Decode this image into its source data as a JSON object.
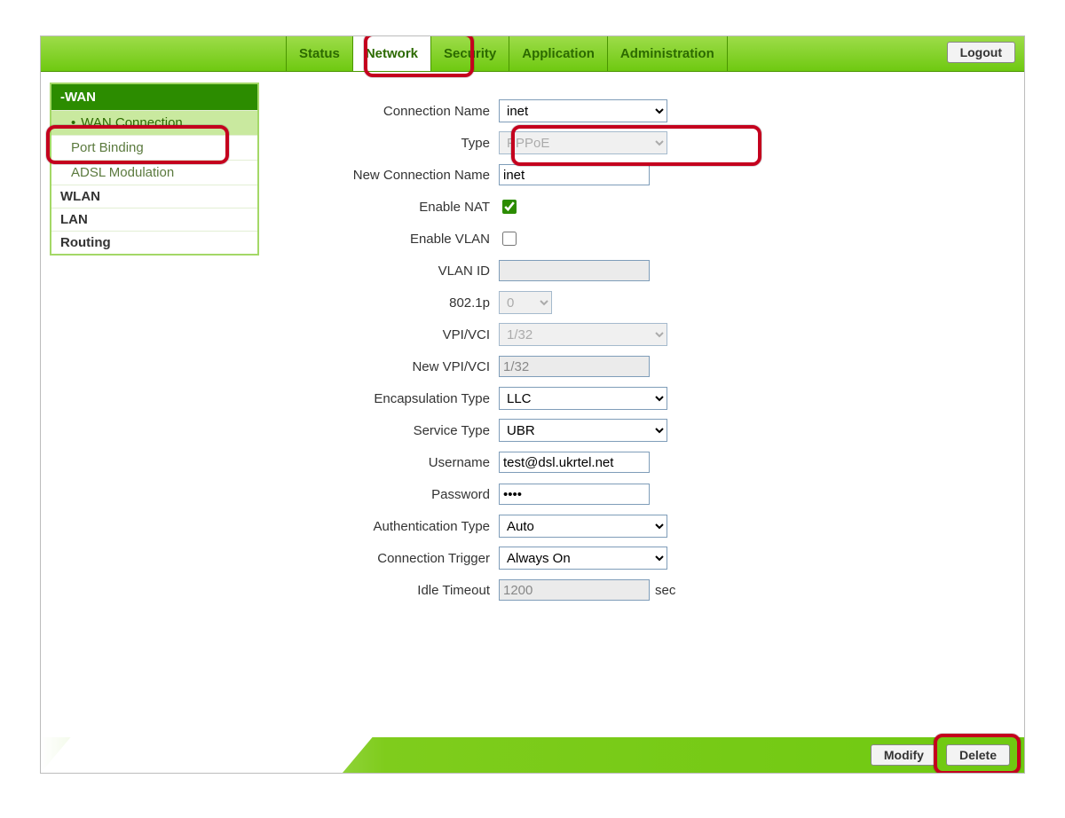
{
  "nav": {
    "tabs": [
      "Status",
      "Network",
      "Security",
      "Application",
      "Administration"
    ],
    "active_index": 1,
    "logout": "Logout"
  },
  "sidebar": {
    "sections": [
      {
        "label": "-WAN",
        "type": "head"
      },
      {
        "label": "WAN Connection",
        "type": "sub",
        "active": true
      },
      {
        "label": "Port Binding",
        "type": "sub"
      },
      {
        "label": "ADSL Modulation",
        "type": "sub"
      },
      {
        "label": "WLAN",
        "type": "group"
      },
      {
        "label": "LAN",
        "type": "group"
      },
      {
        "label": "Routing",
        "type": "group"
      }
    ]
  },
  "form": {
    "connection_name_label": "Connection Name",
    "connection_name_value": "inet",
    "type_label": "Type",
    "type_value": "PPPoE",
    "new_connection_name_label": "New Connection Name",
    "new_connection_name_value": "inet",
    "enable_nat_label": "Enable NAT",
    "enable_nat_checked": true,
    "enable_vlan_label": "Enable VLAN",
    "enable_vlan_checked": false,
    "vlan_id_label": "VLAN ID",
    "vlan_id_value": "",
    "dot1p_label": "802.1p",
    "dot1p_value": "0",
    "vpi_vci_label": "VPI/VCI",
    "vpi_vci_value": "1/32",
    "new_vpi_vci_label": "New VPI/VCI",
    "new_vpi_vci_value": "1/32",
    "encap_label": "Encapsulation Type",
    "encap_value": "LLC",
    "service_type_label": "Service Type",
    "service_type_value": "UBR",
    "username_label": "Username",
    "username_value": "test@dsl.ukrtel.net",
    "password_label": "Password",
    "password_value": "••••",
    "auth_type_label": "Authentication Type",
    "auth_type_value": "Auto",
    "trigger_label": "Connection Trigger",
    "trigger_value": "Always On",
    "idle_timeout_label": "Idle Timeout",
    "idle_timeout_value": "1200",
    "idle_timeout_suffix": "sec"
  },
  "footer": {
    "modify": "Modify",
    "delete": "Delete"
  },
  "colors": {
    "accent_green": "#6fc911",
    "dark_green": "#2c8c00",
    "highlight_red": "#c4001e"
  }
}
